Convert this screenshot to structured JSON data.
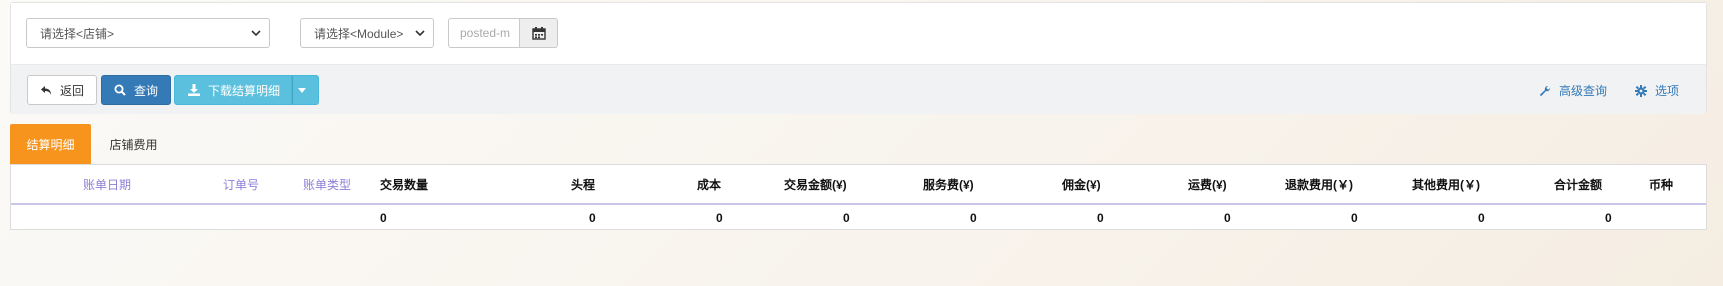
{
  "filters": {
    "shop_select": "请选择<店铺>",
    "module_select": "请选择<Module>",
    "date_placeholder": "posted-m"
  },
  "actions": {
    "back_label": "返回",
    "query_label": "查询",
    "download_label": "下载结算明细",
    "advanced_query_label": "高级查询",
    "options_label": "选项"
  },
  "tabs": [
    {
      "label": "结算明细",
      "active": true
    },
    {
      "label": "店铺费用",
      "active": false
    }
  ],
  "table": {
    "columns": [
      "账单日期",
      "订单号",
      "账单类型",
      "交易数量",
      "头程",
      "成本",
      "交易金额(¥)",
      "服务费(¥)",
      "佣金(¥)",
      "运费(¥)",
      "退款费用(￥)",
      "其他费用(￥)",
      "合计金额",
      "币种"
    ],
    "summary_row": [
      "",
      "",
      "",
      "0",
      "0",
      "0",
      "0",
      "0",
      "0",
      "0",
      "0",
      "0",
      "0",
      ""
    ]
  },
  "colors": {
    "primary": "#337ab7",
    "info": "#5bc0de",
    "tab_active": "#f7941d",
    "sortable_header": "#8c7fd8"
  }
}
